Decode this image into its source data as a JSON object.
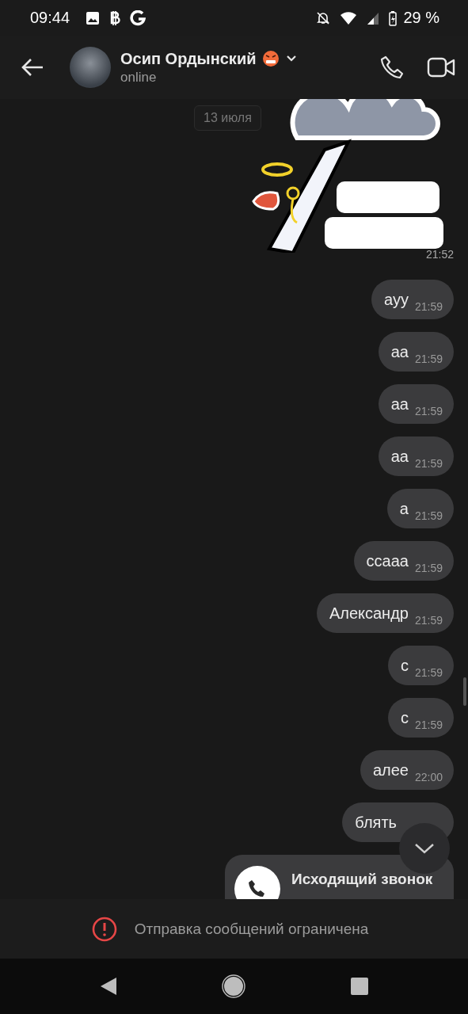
{
  "status_bar": {
    "time": "09:44",
    "battery": "29 %"
  },
  "header": {
    "name": "Осип Ордынский",
    "status": "online"
  },
  "date_chip": "13 июля",
  "sticker": {
    "kind": "picture",
    "time": "21:52"
  },
  "messages": [
    {
      "kind": "text",
      "text": "ауу",
      "time": "21:59"
    },
    {
      "kind": "text",
      "text": "аа",
      "time": "21:59"
    },
    {
      "kind": "text",
      "text": "аа",
      "time": "21:59"
    },
    {
      "kind": "text",
      "text": "аа",
      "time": "21:59"
    },
    {
      "kind": "text",
      "text": "а",
      "time": "21:59"
    },
    {
      "kind": "text",
      "text": "ссааа",
      "time": "21:59"
    },
    {
      "kind": "text",
      "text": "Александр",
      "time": "21:59"
    },
    {
      "kind": "text",
      "text": "с",
      "time": "21:59"
    },
    {
      "kind": "text",
      "text": "с",
      "time": "21:59"
    },
    {
      "kind": "text",
      "text": "алее",
      "time": "22:00"
    },
    {
      "kind": "text",
      "text": "блять"
    },
    {
      "kind": "call",
      "text": "Исходящий звонок"
    }
  ],
  "notice": "Отправка сообщений ограничена"
}
